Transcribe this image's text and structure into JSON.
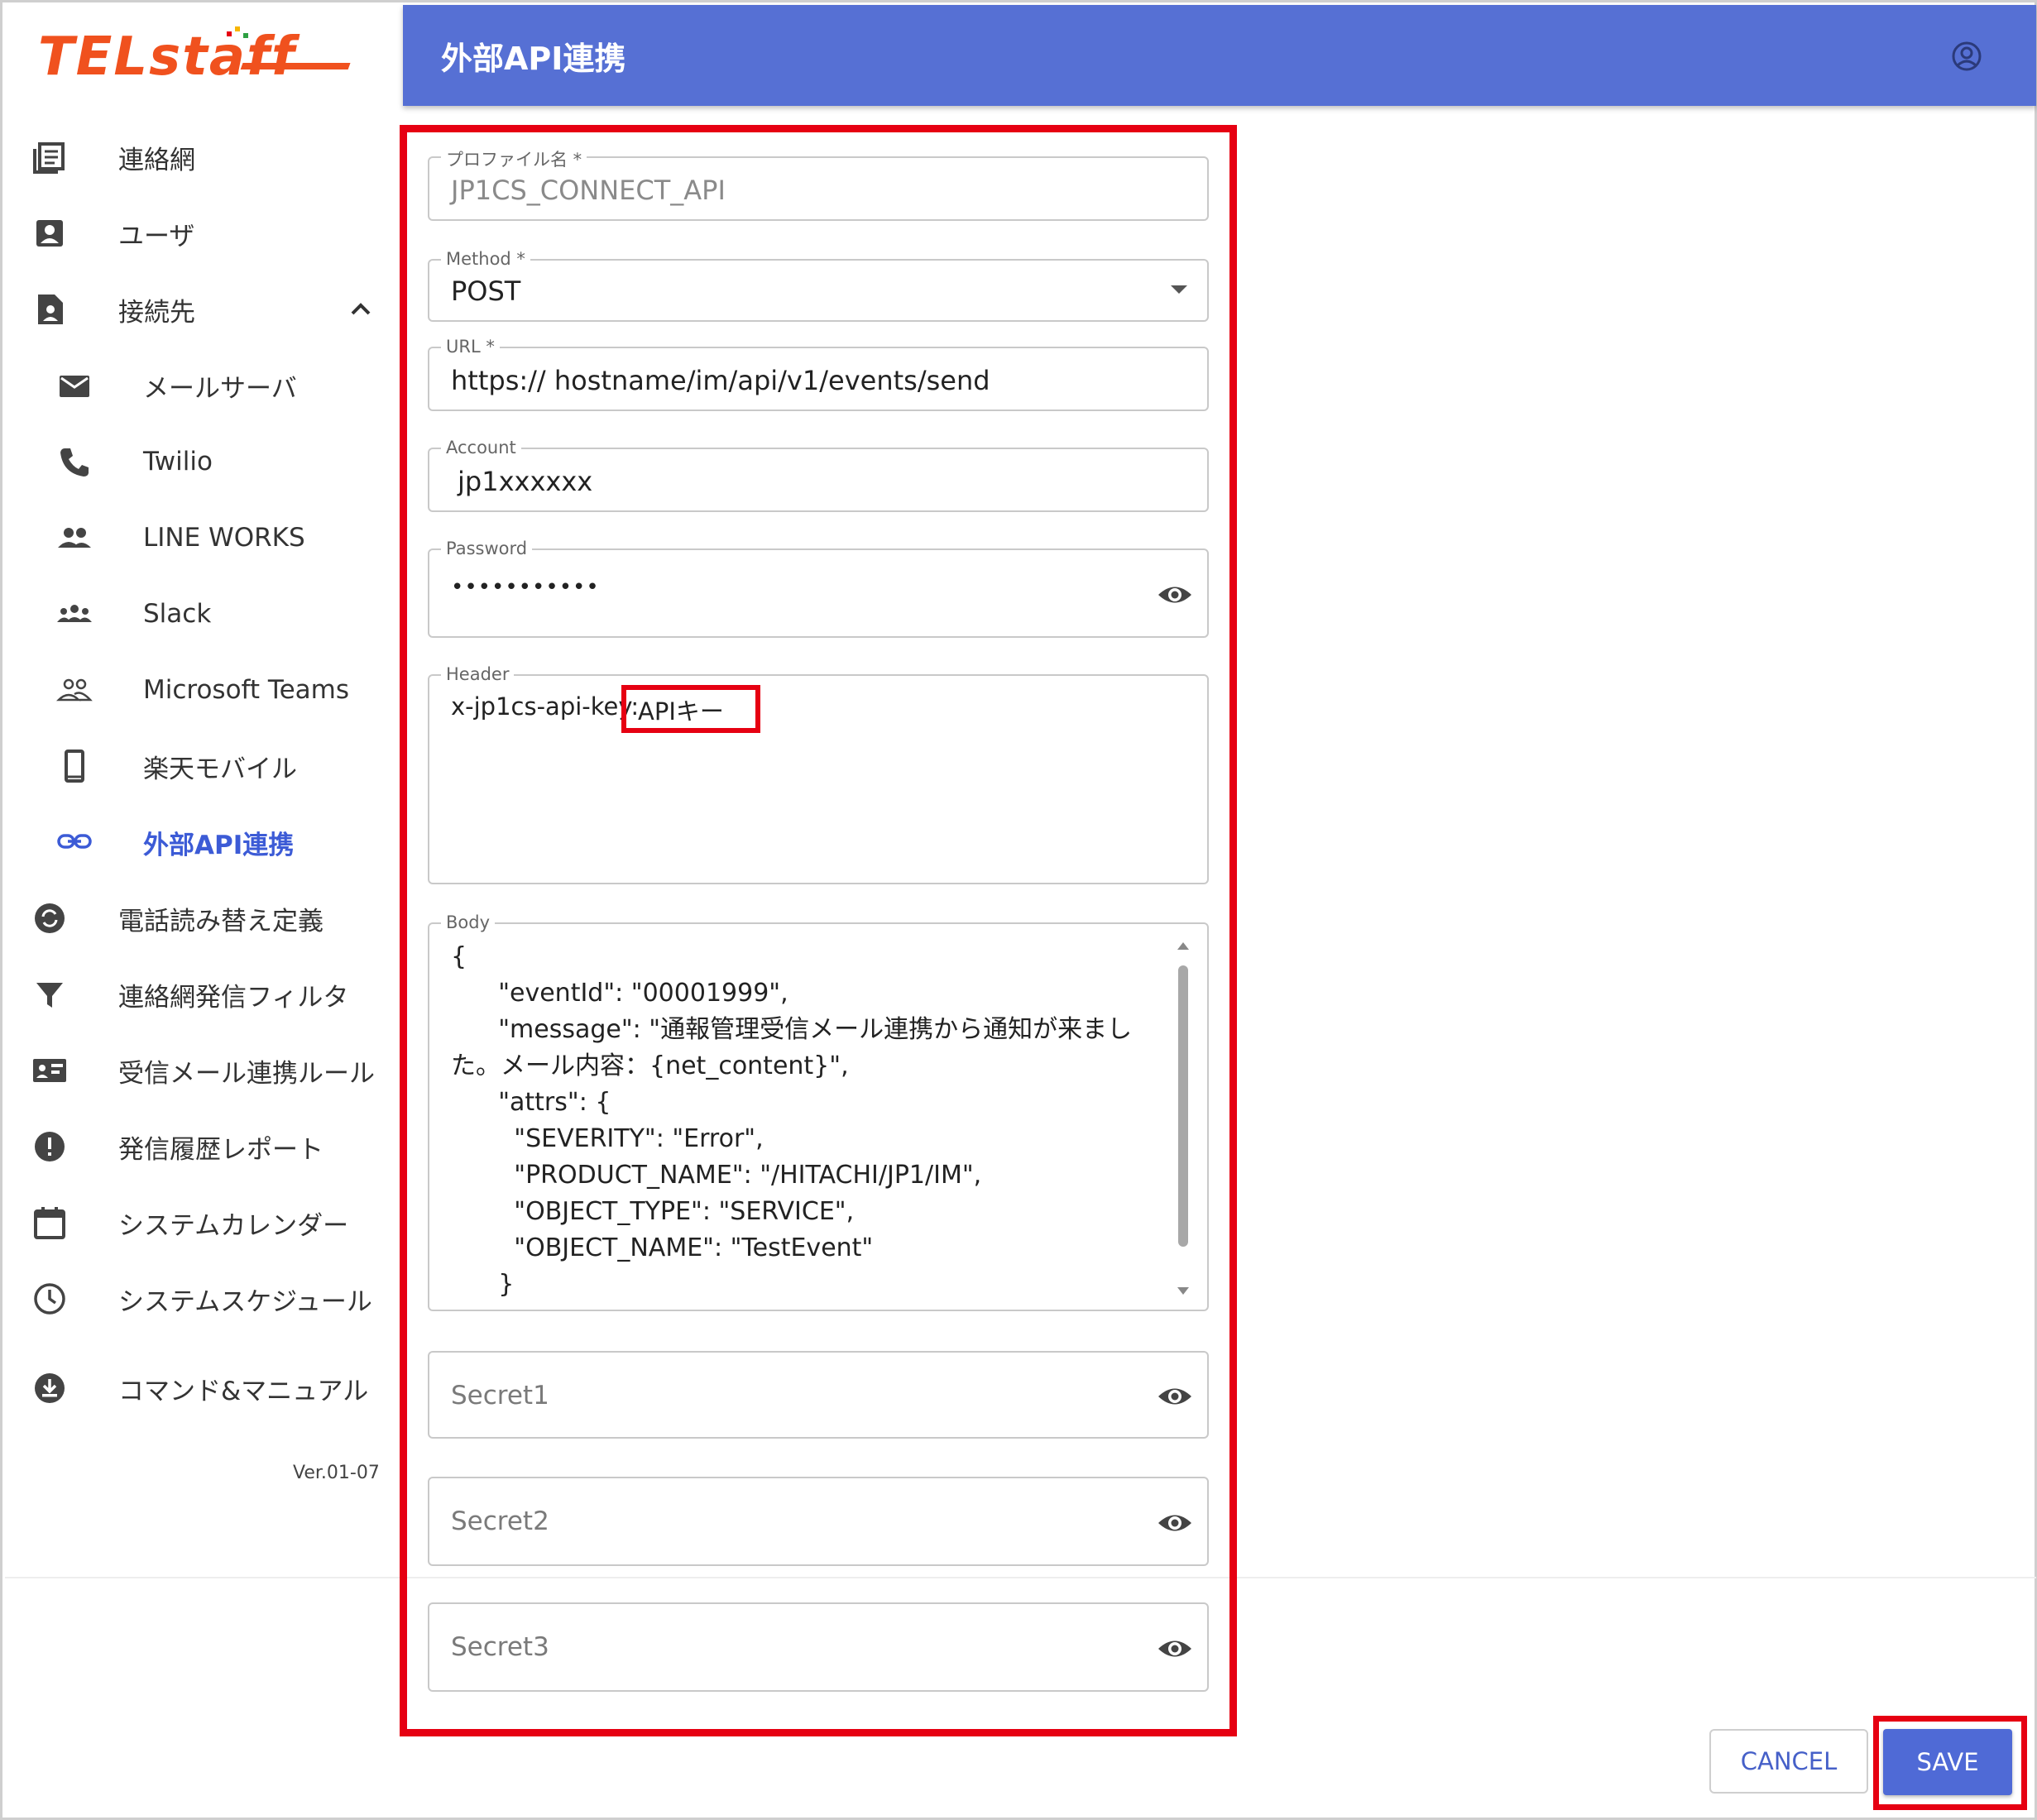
{
  "logo": {
    "text": "TELstaff"
  },
  "header": {
    "title": "外部API連携",
    "account_icon": "account-circle-icon"
  },
  "sidebar": {
    "items": [
      {
        "label": "連絡網",
        "icon": "contact-list-icon"
      },
      {
        "label": "ユーザ",
        "icon": "account-box-icon"
      },
      {
        "label": "接続先",
        "icon": "document-person-icon"
      },
      {
        "label": "メールサーバ",
        "icon": "mail-icon"
      },
      {
        "label": "Twilio",
        "icon": "phone-icon"
      },
      {
        "label": "LINE WORKS",
        "icon": "people-icon"
      },
      {
        "label": "Slack",
        "icon": "groups-icon"
      },
      {
        "label": "Microsoft Teams",
        "icon": "people-outline-icon"
      },
      {
        "label": "楽天モバイル",
        "icon": "smartphone-icon"
      },
      {
        "label": "外部API連携",
        "icon": "link-icon"
      },
      {
        "label": "電話読み替え定義",
        "icon": "sync-circle-icon"
      },
      {
        "label": "連絡網発信フィルタ",
        "icon": "filter-icon"
      },
      {
        "label": "受信メール連携ルール",
        "icon": "contact-mail-icon"
      },
      {
        "label": "発信履歴レポート",
        "icon": "error-icon"
      },
      {
        "label": "システムカレンダー",
        "icon": "calendar-icon"
      },
      {
        "label": "システムスケジュール",
        "icon": "clock-icon"
      },
      {
        "label": "コマンド&マニュアル",
        "icon": "download-circle-icon"
      }
    ],
    "version": "Ver.01-07"
  },
  "form": {
    "profile": {
      "label": "プロファイル名 *",
      "value": "JP1CS_CONNECT_API"
    },
    "method": {
      "label": "Method *",
      "value": "POST"
    },
    "url": {
      "label": "URL *",
      "value": "https:// hostname/im/api/v1/events/send"
    },
    "account": {
      "label": "Account",
      "value": "jp1xxxxxx"
    },
    "password": {
      "label": "Password",
      "value": "•••••••••••"
    },
    "header": {
      "label": "Header",
      "prefix": "x-jp1cs-api-key:",
      "key": "APIキー"
    },
    "body": {
      "label": "Body",
      "lines": [
        "{",
        "      \"eventId\": \"00001999\",",
        "      \"message\": \"通報管理受信メール連携から通知が来まし",
        "た。メール内容：{net_content}\",",
        "      \"attrs\": {",
        "        \"SEVERITY\": \"Error\",",
        "        \"PRODUCT_NAME\": \"/HITACHI/JP1/IM\",",
        "        \"OBJECT_TYPE\": \"SERVICE\",",
        "        \"OBJECT_NAME\": \"TestEvent\"",
        "      }"
      ]
    },
    "secret1": {
      "placeholder": "Secret1"
    },
    "secret2": {
      "placeholder": "Secret2"
    },
    "secret3": {
      "placeholder": "Secret3"
    }
  },
  "actions": {
    "cancel": "CANCEL",
    "save": "SAVE"
  },
  "colors": {
    "header_bg": "#5670d4",
    "highlight": "#e60012",
    "active": "#3c5bd6"
  }
}
